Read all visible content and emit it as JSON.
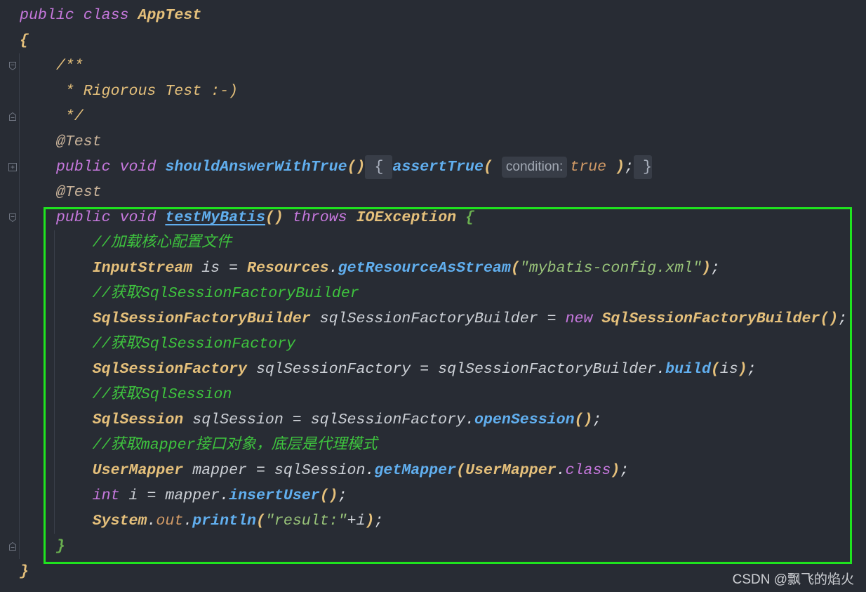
{
  "editor": {
    "colors": {
      "background": "#282c34",
      "keyword": "#c678dd",
      "class_name": "#e5c07b",
      "method": "#61afef",
      "variable": "#ccd0d6",
      "plain": "#dcdfe4",
      "comment": "#3ec43e",
      "doc_comment": "#e5c07b",
      "annotation": "#c9b39a",
      "string": "#98c379",
      "literal": "#d19a66",
      "static_field": "#d19a66",
      "bracket": "#e5c07b",
      "method_brace": "#6aaf50",
      "highlight_box": "#1fe31f"
    },
    "lines": [
      {
        "fold": null,
        "tokens": [
          {
            "t": "public",
            "k": "kw"
          },
          {
            "t": " ",
            "k": "ws"
          },
          {
            "t": "class",
            "k": "kw"
          },
          {
            "t": " ",
            "k": "ws"
          },
          {
            "t": "AppTest",
            "k": "type"
          }
        ]
      },
      {
        "fold": null,
        "tokens": [
          {
            "t": "{",
            "k": "brace"
          }
        ]
      },
      {
        "fold": "open",
        "tokens": [
          {
            "t": "    ",
            "k": "ws"
          },
          {
            "t": "/**",
            "k": "doc"
          }
        ]
      },
      {
        "fold": null,
        "tokens": [
          {
            "t": "     ",
            "k": "ws"
          },
          {
            "t": "* Rigorous Test :-)",
            "k": "doc"
          }
        ]
      },
      {
        "fold": "close",
        "tokens": [
          {
            "t": "     ",
            "k": "ws"
          },
          {
            "t": "*/",
            "k": "doc"
          }
        ]
      },
      {
        "fold": null,
        "tokens": [
          {
            "t": "    ",
            "k": "ws"
          },
          {
            "t": "@Test",
            "k": "anno"
          }
        ]
      },
      {
        "fold": "collapsed",
        "tokens": [
          {
            "t": "    ",
            "k": "ws"
          },
          {
            "t": "public",
            "k": "kw"
          },
          {
            "t": " ",
            "k": "ws"
          },
          {
            "t": "void",
            "k": "kw"
          },
          {
            "t": " ",
            "k": "ws"
          },
          {
            "t": "shouldAnswerWithTrue",
            "k": "fnd"
          },
          {
            "t": "()",
            "k": "paren"
          },
          {
            "t": " { ",
            "k": "fold"
          },
          {
            "t": "assertTrue",
            "k": "fnd"
          },
          {
            "t": "(",
            "k": "paren"
          },
          {
            "t": " ",
            "k": "ws"
          },
          {
            "t": "condition:",
            "k": "hint"
          },
          {
            "t": "true",
            "k": "lit"
          },
          {
            "t": " ",
            "k": "ws"
          },
          {
            "t": ")",
            "k": "paren"
          },
          {
            "t": ";",
            "k": "op"
          },
          {
            "t": " }",
            "k": "fold"
          }
        ]
      },
      {
        "fold": null,
        "tokens": [
          {
            "t": "    ",
            "k": "ws"
          },
          {
            "t": "@Test",
            "k": "anno"
          }
        ]
      },
      {
        "fold": "open",
        "tokens": [
          {
            "t": "    ",
            "k": "ws"
          },
          {
            "t": "public",
            "k": "kw"
          },
          {
            "t": " ",
            "k": "ws"
          },
          {
            "t": "void",
            "k": "kw"
          },
          {
            "t": " ",
            "k": "ws"
          },
          {
            "t": "testMyBatis",
            "k": "fnd",
            "underlined": true
          },
          {
            "t": "()",
            "k": "paren"
          },
          {
            "t": " ",
            "k": "ws"
          },
          {
            "t": "throws",
            "k": "kw"
          },
          {
            "t": " ",
            "k": "ws"
          },
          {
            "t": "IOException",
            "k": "type"
          },
          {
            "t": " ",
            "k": "ws"
          },
          {
            "t": "{",
            "k": "mbrace"
          }
        ]
      },
      {
        "fold": null,
        "tokens": [
          {
            "t": "        ",
            "k": "ws"
          },
          {
            "t": "//加载核心配置文件",
            "k": "cm"
          }
        ]
      },
      {
        "fold": null,
        "tokens": [
          {
            "t": "        ",
            "k": "ws"
          },
          {
            "t": "InputStream",
            "k": "type"
          },
          {
            "t": " ",
            "k": "ws"
          },
          {
            "t": "is",
            "k": "var"
          },
          {
            "t": " = ",
            "k": "op"
          },
          {
            "t": "Resources",
            "k": "type"
          },
          {
            "t": ".",
            "k": "op"
          },
          {
            "t": "getResourceAsStream",
            "k": "fn"
          },
          {
            "t": "(",
            "k": "paren"
          },
          {
            "t": "\"mybatis-config.xml\"",
            "k": "str"
          },
          {
            "t": ")",
            "k": "paren"
          },
          {
            "t": ";",
            "k": "op"
          }
        ]
      },
      {
        "fold": null,
        "tokens": [
          {
            "t": "        ",
            "k": "ws"
          },
          {
            "t": "//获取SqlSessionFactoryBuilder",
            "k": "cm"
          }
        ]
      },
      {
        "fold": null,
        "tokens": [
          {
            "t": "        ",
            "k": "ws"
          },
          {
            "t": "SqlSessionFactoryBuilder",
            "k": "type"
          },
          {
            "t": " ",
            "k": "ws"
          },
          {
            "t": "sqlSessionFactoryBuilder",
            "k": "var"
          },
          {
            "t": " = ",
            "k": "op"
          },
          {
            "t": "new",
            "k": "kw"
          },
          {
            "t": " ",
            "k": "ws"
          },
          {
            "t": "SqlSessionFactoryBuilder",
            "k": "type"
          },
          {
            "t": "()",
            "k": "paren"
          },
          {
            "t": ";",
            "k": "op"
          }
        ]
      },
      {
        "fold": null,
        "tokens": [
          {
            "t": "        ",
            "k": "ws"
          },
          {
            "t": "//获取SqlSessionFactory",
            "k": "cm"
          }
        ]
      },
      {
        "fold": null,
        "tokens": [
          {
            "t": "        ",
            "k": "ws"
          },
          {
            "t": "SqlSessionFactory",
            "k": "type"
          },
          {
            "t": " ",
            "k": "ws"
          },
          {
            "t": "sqlSessionFactory",
            "k": "var"
          },
          {
            "t": " = ",
            "k": "op"
          },
          {
            "t": "sqlSessionFactoryBuilder",
            "k": "var"
          },
          {
            "t": ".",
            "k": "op"
          },
          {
            "t": "build",
            "k": "fn"
          },
          {
            "t": "(",
            "k": "paren"
          },
          {
            "t": "is",
            "k": "var"
          },
          {
            "t": ")",
            "k": "paren"
          },
          {
            "t": ";",
            "k": "op"
          }
        ]
      },
      {
        "fold": null,
        "tokens": [
          {
            "t": "        ",
            "k": "ws"
          },
          {
            "t": "//获取SqlSession",
            "k": "cm"
          }
        ]
      },
      {
        "fold": null,
        "tokens": [
          {
            "t": "        ",
            "k": "ws"
          },
          {
            "t": "SqlSession",
            "k": "type"
          },
          {
            "t": " ",
            "k": "ws"
          },
          {
            "t": "sqlSession",
            "k": "var"
          },
          {
            "t": " = ",
            "k": "op"
          },
          {
            "t": "sqlSessionFactory",
            "k": "var"
          },
          {
            "t": ".",
            "k": "op"
          },
          {
            "t": "openSession",
            "k": "fn"
          },
          {
            "t": "()",
            "k": "paren"
          },
          {
            "t": ";",
            "k": "op"
          }
        ]
      },
      {
        "fold": null,
        "tokens": [
          {
            "t": "        ",
            "k": "ws"
          },
          {
            "t": "//获取mapper接口对象，底层是代理模式",
            "k": "cm"
          }
        ]
      },
      {
        "fold": null,
        "tokens": [
          {
            "t": "        ",
            "k": "ws"
          },
          {
            "t": "UserMapper",
            "k": "type"
          },
          {
            "t": " ",
            "k": "ws"
          },
          {
            "t": "mapper",
            "k": "var"
          },
          {
            "t": " = ",
            "k": "op"
          },
          {
            "t": "sqlSession",
            "k": "var"
          },
          {
            "t": ".",
            "k": "op"
          },
          {
            "t": "getMapper",
            "k": "fn"
          },
          {
            "t": "(",
            "k": "paren"
          },
          {
            "t": "UserMapper",
            "k": "type"
          },
          {
            "t": ".",
            "k": "op"
          },
          {
            "t": "class",
            "k": "kw"
          },
          {
            "t": ")",
            "k": "paren"
          },
          {
            "t": ";",
            "k": "op"
          }
        ]
      },
      {
        "fold": null,
        "tokens": [
          {
            "t": "        ",
            "k": "ws"
          },
          {
            "t": "int",
            "k": "kw"
          },
          {
            "t": " ",
            "k": "ws"
          },
          {
            "t": "i",
            "k": "var"
          },
          {
            "t": " = ",
            "k": "op"
          },
          {
            "t": "mapper",
            "k": "var"
          },
          {
            "t": ".",
            "k": "op"
          },
          {
            "t": "insertUser",
            "k": "fn"
          },
          {
            "t": "()",
            "k": "paren"
          },
          {
            "t": ";",
            "k": "op"
          }
        ]
      },
      {
        "fold": null,
        "tokens": [
          {
            "t": "        ",
            "k": "ws"
          },
          {
            "t": "System",
            "k": "type"
          },
          {
            "t": ".",
            "k": "op"
          },
          {
            "t": "out",
            "k": "field"
          },
          {
            "t": ".",
            "k": "op"
          },
          {
            "t": "println",
            "k": "fn"
          },
          {
            "t": "(",
            "k": "paren"
          },
          {
            "t": "\"result:\"",
            "k": "str"
          },
          {
            "t": "+",
            "k": "op"
          },
          {
            "t": "i",
            "k": "var"
          },
          {
            "t": ")",
            "k": "paren"
          },
          {
            "t": ";",
            "k": "op"
          }
        ]
      },
      {
        "fold": "close",
        "tokens": [
          {
            "t": "    ",
            "k": "ws"
          },
          {
            "t": "}",
            "k": "mbrace"
          }
        ]
      },
      {
        "fold": null,
        "tokens": [
          {
            "t": "}",
            "k": "brace"
          }
        ]
      }
    ]
  },
  "watermark": "CSDN @飘飞的焰火"
}
